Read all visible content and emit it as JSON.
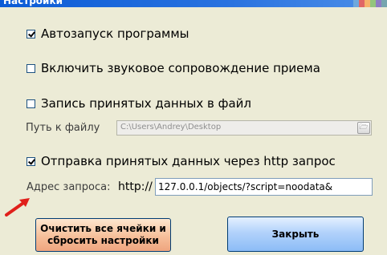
{
  "window": {
    "title": "Настройки"
  },
  "settings": {
    "autostart": {
      "label": "Автозапуск программы",
      "checked": true
    },
    "sound": {
      "label": "Включить звуковое сопровождение приема",
      "checked": false
    },
    "log_to_file": {
      "label": "Запись принятых данных в файл",
      "checked": false
    },
    "file_path": {
      "label": "Путь к файлу",
      "value": "C:\\Users\\Andrey\\Desktop"
    },
    "http_send": {
      "label": "Отправка принятых данных через http запрос",
      "checked": true
    },
    "request_address": {
      "label": "Адрес запроса:",
      "prefix": "http://",
      "value": "127.0.0.1/objects/?script=noodata&"
    }
  },
  "buttons": {
    "reset_line1": "Очистить все ячейки и",
    "reset_line2": "сбросить настройки",
    "close": "Закрыть"
  },
  "colors": {
    "background": "#ecebd6",
    "titlebar": "#0b5bd6",
    "reset_button": "#f6bf9a",
    "close_button": "#b2d2fb",
    "arrow": "#e0201b"
  }
}
